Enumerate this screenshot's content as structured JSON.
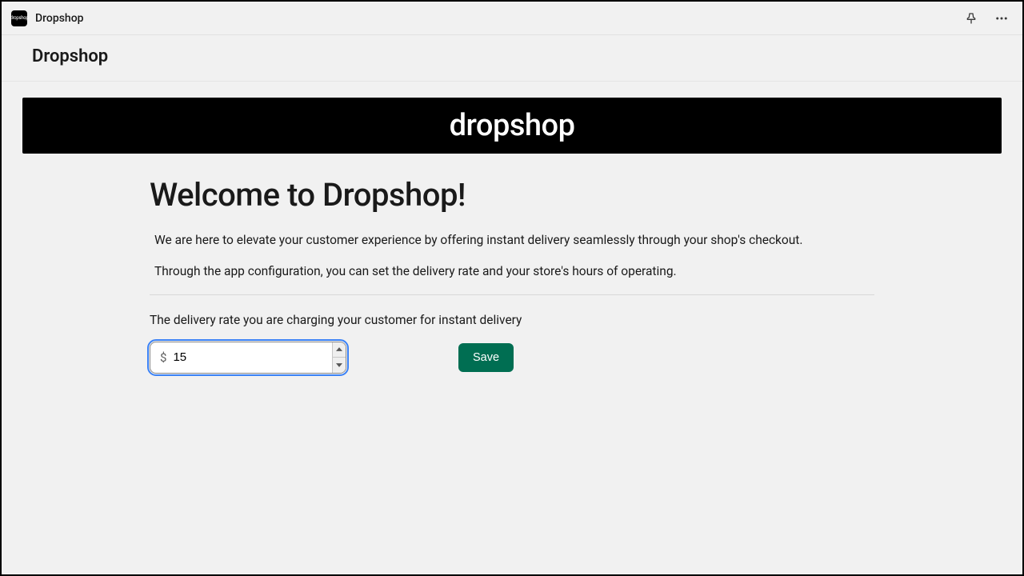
{
  "appbar": {
    "app_name": "Dropshop",
    "logo_text": "dropshop"
  },
  "header": {
    "title": "Dropshop"
  },
  "banner": {
    "brand_text": "dropshop"
  },
  "main": {
    "welcome_heading": "Welcome to Dropshop!",
    "intro_1": "We are here to elevate your customer experience by offering instant delivery seamlessly through your shop's checkout.",
    "intro_2": "Through the app configuration, you can set the delivery rate and your store's hours of operating.",
    "rate_label": "The delivery rate you are charging your customer for instant delivery",
    "currency_symbol": "$",
    "rate_value": "15",
    "save_label": "Save"
  },
  "colors": {
    "accent": "#006e52",
    "focus": "#3b82f6"
  }
}
